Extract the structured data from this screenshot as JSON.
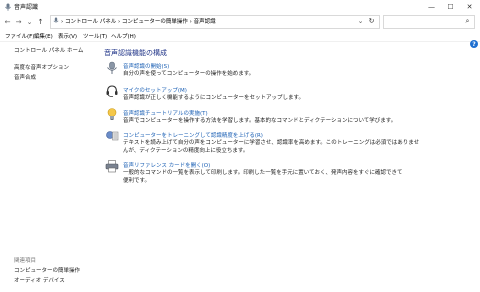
{
  "window": {
    "title": "音声認識",
    "controls": [
      "—",
      "☐",
      "✕"
    ]
  },
  "nav": {
    "back": "←",
    "forward": "→",
    "down": "⌄",
    "up": "↑",
    "breadcrumb": "›  コントロール パネル  ›  コンピューターの簡単操作  ›  音声認識",
    "dropdown": "⌄",
    "refresh": "↻",
    "search_icon": "⌕"
  },
  "menu": [
    "ファイル(F)",
    "編集(E)",
    "表示(V)",
    "ツール(T)",
    "ヘルプ(H)"
  ],
  "sidebar": {
    "home": "コントロール パネル ホーム",
    "links": [
      "高度な音声オプション",
      "音声合成"
    ],
    "see_also_title": "関連項目",
    "see_also": [
      "コンピューターの簡単操作",
      "オーディオ デバイス"
    ]
  },
  "main": {
    "heading": "音声認識機能の構成",
    "items": [
      {
        "icon": "microphone-icon",
        "link": "音声認識の開始(S)",
        "desc": [
          "自分の声を使ってコンピューターの操作を始めます。"
        ]
      },
      {
        "icon": "headset-icon",
        "link": "マイクのセットアップ(M)",
        "desc": [
          "音声認識が正しく機能するようにコンピューターをセットアップします。"
        ]
      },
      {
        "icon": "lightbulb-icon",
        "link": "音声認識チュートリアルの実施(T)",
        "desc": [
          "音声でコンピューターを操作する方法を学習します。基本的なコマンドとディクテーションについて学びます。"
        ]
      },
      {
        "icon": "training-icon",
        "link": "コンピューターをトレーニングして認識精度を上げる(R)",
        "desc": [
          "テキストを読み上げて自分の声をコンピューターに学習させ、認識率を高めます。このトレーニングは必須ではありませ",
          "んが、ディクテーションの精度向上に役立ちます。"
        ]
      },
      {
        "icon": "printer-icon",
        "link": "音声リファレンス カードを開く(O)",
        "desc": [
          "一般的なコマンドの一覧を表示して印刷します。印刷した一覧を手元に置いておく、発声内容をすぐに確認できて",
          "便利です。"
        ]
      }
    ]
  },
  "help_label": "?"
}
